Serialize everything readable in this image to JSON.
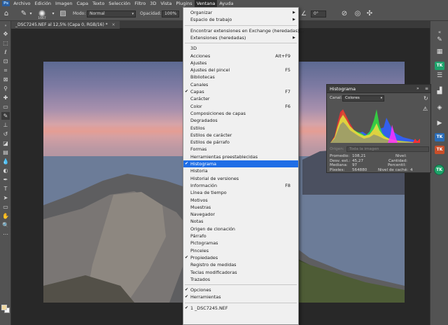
{
  "menubar": {
    "items": [
      "Archivo",
      "Edición",
      "Imagen",
      "Capa",
      "Texto",
      "Selección",
      "Filtro",
      "3D",
      "Vista",
      "Plugins",
      "Ventana",
      "Ayuda"
    ],
    "active_index": 10
  },
  "options": {
    "brush_size": "1667",
    "mode_label": "Modo:",
    "mode_value": "Normal",
    "opacity_label": "Opacidad:",
    "opacity_value": "100%",
    "angle_value": "0°"
  },
  "document": {
    "tab_title": "_DSC7245.NEF al 12,5% (Capa 0, RGB/16) *",
    "close": "×"
  },
  "ventana_menu": {
    "items": [
      {
        "label": "Organizar",
        "arrow": true
      },
      {
        "label": "Espacio de trabajo",
        "arrow": true
      },
      {
        "sep": true
      },
      {
        "label": "Encontrar extensiones en Exchange (heredadas)..."
      },
      {
        "label": "Extensiones (heredadas)",
        "arrow": true
      },
      {
        "sep": true
      },
      {
        "label": "3D"
      },
      {
        "label": "Acciones",
        "shortcut": "Alt+F9"
      },
      {
        "label": "Ajustes"
      },
      {
        "label": "Ajustes del pincel",
        "shortcut": "F5"
      },
      {
        "label": "Bibliotecas"
      },
      {
        "label": "Canales"
      },
      {
        "label": "Capas",
        "shortcut": "F7",
        "checked": true
      },
      {
        "label": "Carácter"
      },
      {
        "label": "Color",
        "shortcut": "F6"
      },
      {
        "label": "Composiciones de capas"
      },
      {
        "label": "Degradados"
      },
      {
        "label": "Estilos"
      },
      {
        "label": "Estilos de carácter"
      },
      {
        "label": "Estilos de párrafo"
      },
      {
        "label": "Formas"
      },
      {
        "label": "Herramientas preestablecidas"
      },
      {
        "label": "Histograma",
        "checked": true,
        "highlighted": true
      },
      {
        "label": "Historia"
      },
      {
        "label": "Historial de versiones"
      },
      {
        "label": "Información",
        "shortcut": "F8"
      },
      {
        "label": "Línea de tiempo"
      },
      {
        "label": "Motivos"
      },
      {
        "label": "Muestras"
      },
      {
        "label": "Navegador"
      },
      {
        "label": "Notas"
      },
      {
        "label": "Origen de clonación"
      },
      {
        "label": "Párrafo"
      },
      {
        "label": "Pictogramas"
      },
      {
        "label": "Pinceles"
      },
      {
        "label": "Propiedades",
        "checked": true
      },
      {
        "label": "Registro de medidas"
      },
      {
        "label": "Teclas modificadoras"
      },
      {
        "label": "Trazados"
      },
      {
        "sep": true
      },
      {
        "label": "Opciones",
        "checked": true
      },
      {
        "label": "Herramientas",
        "checked": true
      },
      {
        "sep": true
      },
      {
        "label": "1 _DSC7245.NEF",
        "checked": true
      }
    ]
  },
  "histogram_panel": {
    "title": "Histograma",
    "channel_label": "Canal:",
    "channel_value": "Colores",
    "source_label": "Origen:",
    "source_value": "Toda la imagen",
    "stats_left": [
      {
        "label": "Promedio:",
        "value": "108,21"
      },
      {
        "label": "Desv. est.:",
        "value": "45,27"
      },
      {
        "label": "Mediana:",
        "value": "97"
      },
      {
        "label": "Píxeles:",
        "value": "564880"
      }
    ],
    "stats_right": [
      {
        "label": "Nivel:",
        "value": ""
      },
      {
        "label": "Cantidad:",
        "value": ""
      },
      {
        "label": "Percentil:",
        "value": ""
      },
      {
        "label": "Nivel de caché:",
        "value": "4"
      }
    ]
  },
  "right_dock": {
    "badges": [
      "TK",
      "TK",
      "TK",
      "TK"
    ]
  }
}
